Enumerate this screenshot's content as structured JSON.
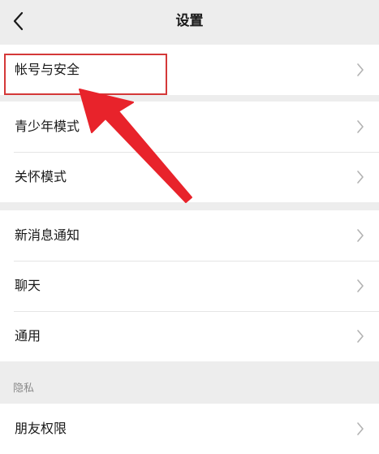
{
  "header": {
    "title": "设置"
  },
  "groups": [
    {
      "items": [
        {
          "label": "帐号与安全"
        }
      ]
    },
    {
      "items": [
        {
          "label": "青少年模式"
        },
        {
          "label": "关怀模式"
        }
      ]
    },
    {
      "items": [
        {
          "label": "新消息通知"
        },
        {
          "label": "聊天"
        },
        {
          "label": "通用"
        }
      ]
    }
  ],
  "privacy": {
    "header": "隐私",
    "items": [
      {
        "label": "朋友权限"
      }
    ]
  },
  "colors": {
    "background": "#ededed",
    "card": "#ffffff",
    "annotation_red": "#e8232b",
    "chevron": "#b2b2b2"
  },
  "icons": {
    "back": "back-chevron-icon",
    "row_chevron": "chevron-right-icon"
  }
}
